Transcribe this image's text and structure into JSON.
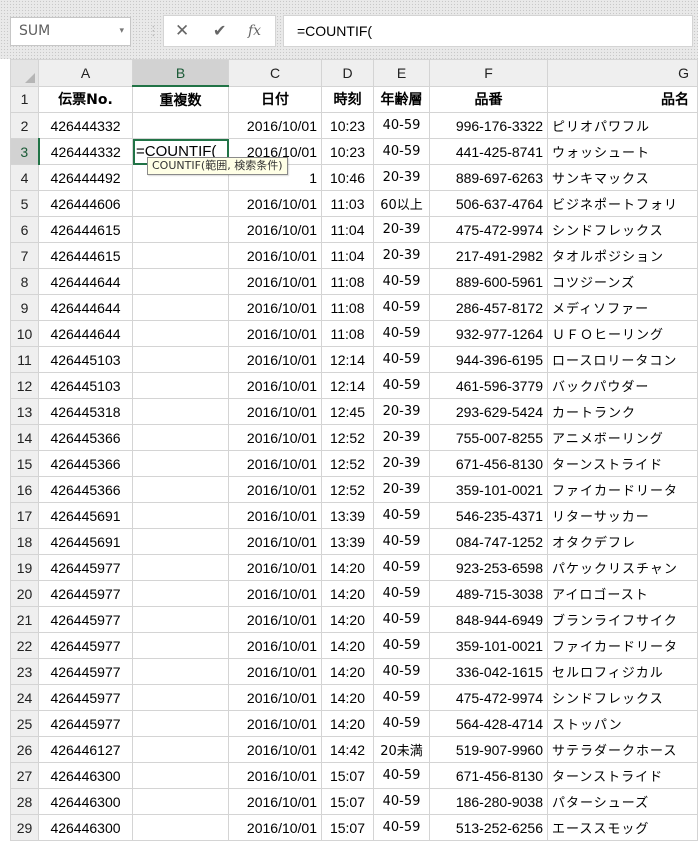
{
  "formula_bar": {
    "name_box": "SUM",
    "dropdown_icon": "▾",
    "separator": "⋮",
    "cancel_icon": "✕",
    "enter_icon": "✔",
    "fx_icon": "fx",
    "formula": "=COUNTIF("
  },
  "columns": [
    "A",
    "B",
    "C",
    "D",
    "E",
    "F",
    "G"
  ],
  "headers": [
    "伝票No.",
    "重複数",
    "日付",
    "時刻",
    "年齢層",
    "品番",
    "品名"
  ],
  "edit_cell": {
    "text": "=COUNTIF("
  },
  "tooltip": "COUNTIF(範囲, 検索条件)",
  "rows": [
    {
      "row": "2",
      "a": "426444332",
      "b": "",
      "c": "2016/10/01",
      "d": "10:23",
      "e": "40-59",
      "f": "996-176-3322",
      "g": "ピリオパワフル"
    },
    {
      "row": "3",
      "a": "426444332",
      "b": "",
      "c": "2016/10/01",
      "d": "10:23",
      "e": "40-59",
      "f": "441-425-8741",
      "g": "ウォッシュート"
    },
    {
      "row": "4",
      "a": "426444492",
      "b": "",
      "c": "1",
      "d": "10:46",
      "e": "20-39",
      "f": "889-697-6263",
      "g": "サンキマックス"
    },
    {
      "row": "5",
      "a": "426444606",
      "b": "",
      "c": "2016/10/01",
      "d": "11:03",
      "e": "60以上",
      "f": "506-637-4764",
      "g": "ビジネポートフォリ"
    },
    {
      "row": "6",
      "a": "426444615",
      "b": "",
      "c": "2016/10/01",
      "d": "11:04",
      "e": "20-39",
      "f": "475-472-9974",
      "g": "シンドフレックス"
    },
    {
      "row": "7",
      "a": "426444615",
      "b": "",
      "c": "2016/10/01",
      "d": "11:04",
      "e": "20-39",
      "f": "217-491-2982",
      "g": "タオルポジション"
    },
    {
      "row": "8",
      "a": "426444644",
      "b": "",
      "c": "2016/10/01",
      "d": "11:08",
      "e": "40-59",
      "f": "889-600-5961",
      "g": "コツジーンズ"
    },
    {
      "row": "9",
      "a": "426444644",
      "b": "",
      "c": "2016/10/01",
      "d": "11:08",
      "e": "40-59",
      "f": "286-457-8172",
      "g": "メディソファー"
    },
    {
      "row": "10",
      "a": "426444644",
      "b": "",
      "c": "2016/10/01",
      "d": "11:08",
      "e": "40-59",
      "f": "932-977-1264",
      "g": "ＵＦＯヒーリング"
    },
    {
      "row": "11",
      "a": "426445103",
      "b": "",
      "c": "2016/10/01",
      "d": "12:14",
      "e": "40-59",
      "f": "944-396-6195",
      "g": "ロースロリータコン"
    },
    {
      "row": "12",
      "a": "426445103",
      "b": "",
      "c": "2016/10/01",
      "d": "12:14",
      "e": "40-59",
      "f": "461-596-3779",
      "g": "バックパウダー"
    },
    {
      "row": "13",
      "a": "426445318",
      "b": "",
      "c": "2016/10/01",
      "d": "12:45",
      "e": "20-39",
      "f": "293-629-5424",
      "g": "カートランク"
    },
    {
      "row": "14",
      "a": "426445366",
      "b": "",
      "c": "2016/10/01",
      "d": "12:52",
      "e": "20-39",
      "f": "755-007-8255",
      "g": "アニメボーリング"
    },
    {
      "row": "15",
      "a": "426445366",
      "b": "",
      "c": "2016/10/01",
      "d": "12:52",
      "e": "20-39",
      "f": "671-456-8130",
      "g": "ターンストライド"
    },
    {
      "row": "16",
      "a": "426445366",
      "b": "",
      "c": "2016/10/01",
      "d": "12:52",
      "e": "20-39",
      "f": "359-101-0021",
      "g": "ファイカードリータ"
    },
    {
      "row": "17",
      "a": "426445691",
      "b": "",
      "c": "2016/10/01",
      "d": "13:39",
      "e": "40-59",
      "f": "546-235-4371",
      "g": "リターサッカー"
    },
    {
      "row": "18",
      "a": "426445691",
      "b": "",
      "c": "2016/10/01",
      "d": "13:39",
      "e": "40-59",
      "f": "084-747-1252",
      "g": "オタクデフレ"
    },
    {
      "row": "19",
      "a": "426445977",
      "b": "",
      "c": "2016/10/01",
      "d": "14:20",
      "e": "40-59",
      "f": "923-253-6598",
      "g": "パケックリスチャン"
    },
    {
      "row": "20",
      "a": "426445977",
      "b": "",
      "c": "2016/10/01",
      "d": "14:20",
      "e": "40-59",
      "f": "489-715-3038",
      "g": "アイロゴースト"
    },
    {
      "row": "21",
      "a": "426445977",
      "b": "",
      "c": "2016/10/01",
      "d": "14:20",
      "e": "40-59",
      "f": "848-944-6949",
      "g": "ブランライフサイク"
    },
    {
      "row": "22",
      "a": "426445977",
      "b": "",
      "c": "2016/10/01",
      "d": "14:20",
      "e": "40-59",
      "f": "359-101-0021",
      "g": "ファイカードリータ"
    },
    {
      "row": "23",
      "a": "426445977",
      "b": "",
      "c": "2016/10/01",
      "d": "14:20",
      "e": "40-59",
      "f": "336-042-1615",
      "g": "セルロフィジカル"
    },
    {
      "row": "24",
      "a": "426445977",
      "b": "",
      "c": "2016/10/01",
      "d": "14:20",
      "e": "40-59",
      "f": "475-472-9974",
      "g": "シンドフレックス"
    },
    {
      "row": "25",
      "a": "426445977",
      "b": "",
      "c": "2016/10/01",
      "d": "14:20",
      "e": "40-59",
      "f": "564-428-4714",
      "g": "ストッパン"
    },
    {
      "row": "26",
      "a": "426446127",
      "b": "",
      "c": "2016/10/01",
      "d": "14:42",
      "e": "20未満",
      "f": "519-907-9960",
      "g": "サテラダークホース"
    },
    {
      "row": "27",
      "a": "426446300",
      "b": "",
      "c": "2016/10/01",
      "d": "15:07",
      "e": "40-59",
      "f": "671-456-8130",
      "g": "ターンストライド"
    },
    {
      "row": "28",
      "a": "426446300",
      "b": "",
      "c": "2016/10/01",
      "d": "15:07",
      "e": "40-59",
      "f": "186-280-9038",
      "g": "パターシューズ"
    },
    {
      "row": "29",
      "a": "426446300",
      "b": "",
      "c": "2016/10/01",
      "d": "15:07",
      "e": "40-59",
      "f": "513-252-6256",
      "g": "エーススモッグ"
    }
  ]
}
